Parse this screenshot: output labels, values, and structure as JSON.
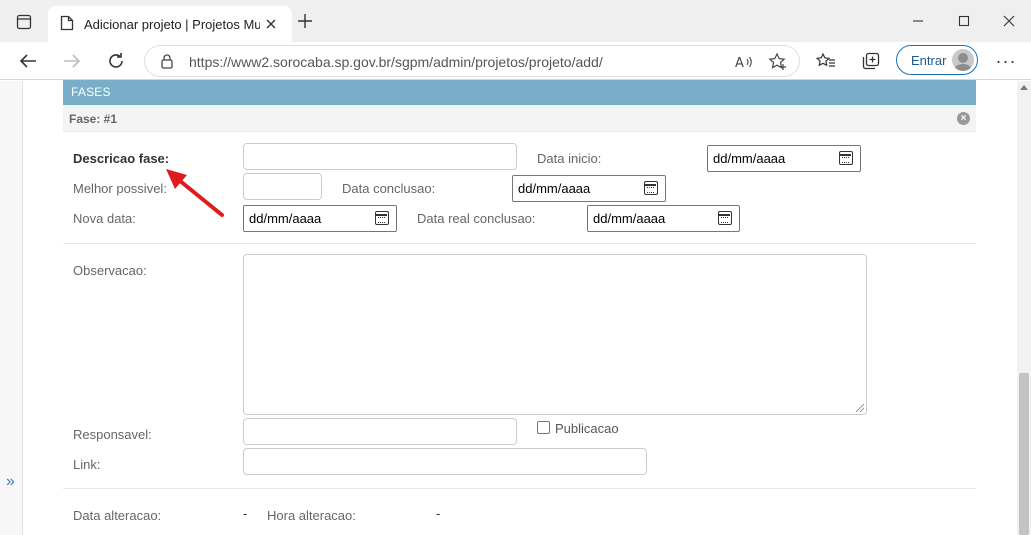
{
  "browser": {
    "tab_title": "Adicionar projeto | Projetos Mun",
    "url": "https://www2.sorocaba.sp.gov.br/sgpm/admin/projetos/projeto/add/",
    "signin_label": "Entrar",
    "more_label": "···"
  },
  "page": {
    "module_title": "FASES",
    "inline_title": "Fase: #1",
    "inline_delete": "×",
    "expander": "»",
    "fields": {
      "descricao_label": "Descricao fase:",
      "data_inicio_label": "Data inicio:",
      "data_inicio_value": "dd/mm/aaaa",
      "melhor_possivel_label": "Melhor possivel:",
      "data_conclusao_label": "Data conclusao:",
      "data_conclusao_value": "dd/mm/aaaa",
      "nova_data_label": "Nova data:",
      "nova_data_value": "dd/mm/aaaa",
      "data_real_conclusao_label": "Data real conclusao:",
      "data_real_conclusao_value": "dd/mm/aaaa",
      "observacao_label": "Observacao:",
      "responsavel_label": "Responsavel:",
      "publicacao_label": "Publicacao",
      "link_label": "Link:",
      "data_alteracao_label": "Data alteracao:",
      "data_alteracao_value": "-",
      "hora_alteracao_label": "Hora alteracao:",
      "hora_alteracao_value": "-"
    }
  },
  "colors": {
    "module_header": "#79aec8",
    "annotation_arrow": "#e01b1b"
  }
}
